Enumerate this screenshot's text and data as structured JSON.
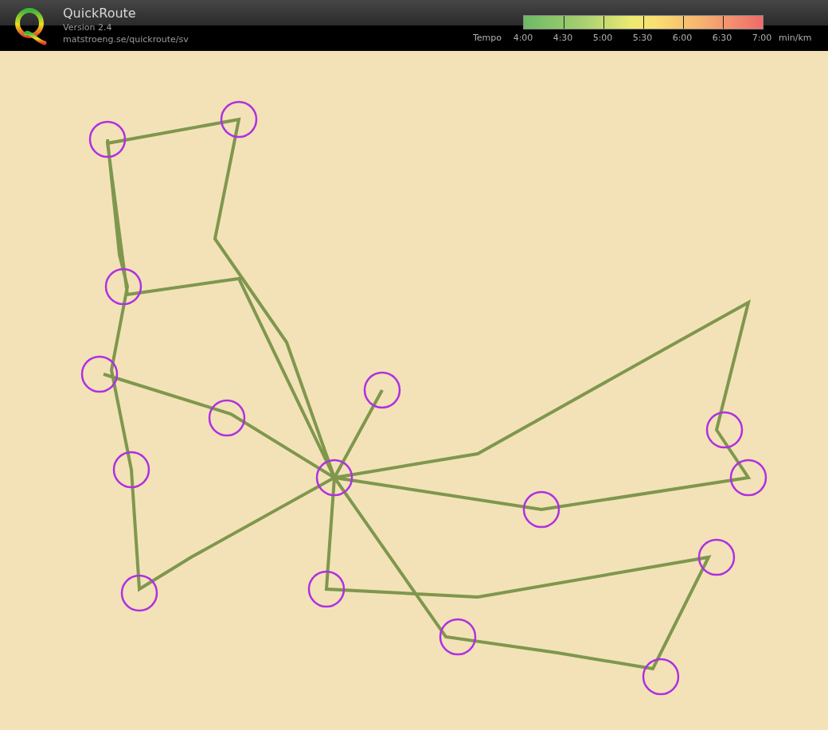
{
  "header": {
    "title": "QuickRoute",
    "version": "Version 2.4",
    "url": "matstroeng.se/quickroute/sv"
  },
  "legend": {
    "label": "Tempo",
    "ticks": [
      "4:00",
      "4:30",
      "5:00",
      "5:30",
      "6:00",
      "6:30",
      "7:00"
    ],
    "unit": "min/km"
  }
}
